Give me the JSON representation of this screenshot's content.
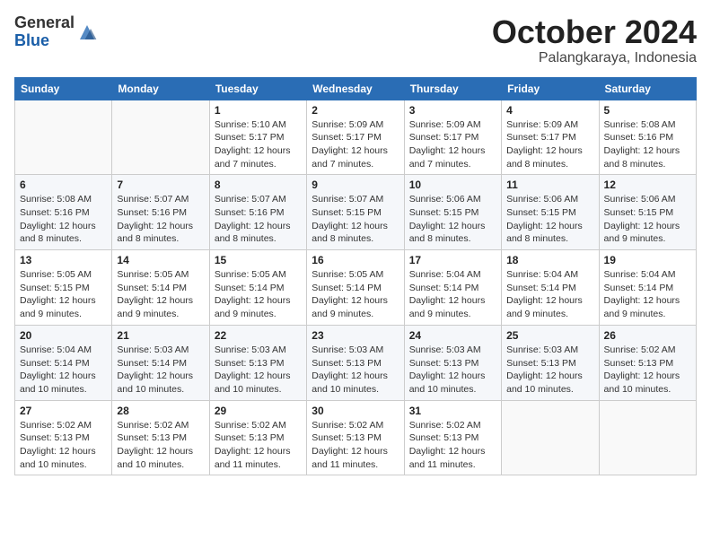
{
  "header": {
    "logo_general": "General",
    "logo_blue": "Blue",
    "month": "October 2024",
    "location": "Palangkaraya, Indonesia"
  },
  "days_of_week": [
    "Sunday",
    "Monday",
    "Tuesday",
    "Wednesday",
    "Thursday",
    "Friday",
    "Saturday"
  ],
  "weeks": [
    [
      {
        "day": "",
        "detail": ""
      },
      {
        "day": "",
        "detail": ""
      },
      {
        "day": "1",
        "detail": "Sunrise: 5:10 AM\nSunset: 5:17 PM\nDaylight: 12 hours\nand 7 minutes."
      },
      {
        "day": "2",
        "detail": "Sunrise: 5:09 AM\nSunset: 5:17 PM\nDaylight: 12 hours\nand 7 minutes."
      },
      {
        "day": "3",
        "detail": "Sunrise: 5:09 AM\nSunset: 5:17 PM\nDaylight: 12 hours\nand 7 minutes."
      },
      {
        "day": "4",
        "detail": "Sunrise: 5:09 AM\nSunset: 5:17 PM\nDaylight: 12 hours\nand 8 minutes."
      },
      {
        "day": "5",
        "detail": "Sunrise: 5:08 AM\nSunset: 5:16 PM\nDaylight: 12 hours\nand 8 minutes."
      }
    ],
    [
      {
        "day": "6",
        "detail": "Sunrise: 5:08 AM\nSunset: 5:16 PM\nDaylight: 12 hours\nand 8 minutes."
      },
      {
        "day": "7",
        "detail": "Sunrise: 5:07 AM\nSunset: 5:16 PM\nDaylight: 12 hours\nand 8 minutes."
      },
      {
        "day": "8",
        "detail": "Sunrise: 5:07 AM\nSunset: 5:16 PM\nDaylight: 12 hours\nand 8 minutes."
      },
      {
        "day": "9",
        "detail": "Sunrise: 5:07 AM\nSunset: 5:15 PM\nDaylight: 12 hours\nand 8 minutes."
      },
      {
        "day": "10",
        "detail": "Sunrise: 5:06 AM\nSunset: 5:15 PM\nDaylight: 12 hours\nand 8 minutes."
      },
      {
        "day": "11",
        "detail": "Sunrise: 5:06 AM\nSunset: 5:15 PM\nDaylight: 12 hours\nand 8 minutes."
      },
      {
        "day": "12",
        "detail": "Sunrise: 5:06 AM\nSunset: 5:15 PM\nDaylight: 12 hours\nand 9 minutes."
      }
    ],
    [
      {
        "day": "13",
        "detail": "Sunrise: 5:05 AM\nSunset: 5:15 PM\nDaylight: 12 hours\nand 9 minutes."
      },
      {
        "day": "14",
        "detail": "Sunrise: 5:05 AM\nSunset: 5:14 PM\nDaylight: 12 hours\nand 9 minutes."
      },
      {
        "day": "15",
        "detail": "Sunrise: 5:05 AM\nSunset: 5:14 PM\nDaylight: 12 hours\nand 9 minutes."
      },
      {
        "day": "16",
        "detail": "Sunrise: 5:05 AM\nSunset: 5:14 PM\nDaylight: 12 hours\nand 9 minutes."
      },
      {
        "day": "17",
        "detail": "Sunrise: 5:04 AM\nSunset: 5:14 PM\nDaylight: 12 hours\nand 9 minutes."
      },
      {
        "day": "18",
        "detail": "Sunrise: 5:04 AM\nSunset: 5:14 PM\nDaylight: 12 hours\nand 9 minutes."
      },
      {
        "day": "19",
        "detail": "Sunrise: 5:04 AM\nSunset: 5:14 PM\nDaylight: 12 hours\nand 9 minutes."
      }
    ],
    [
      {
        "day": "20",
        "detail": "Sunrise: 5:04 AM\nSunset: 5:14 PM\nDaylight: 12 hours\nand 10 minutes."
      },
      {
        "day": "21",
        "detail": "Sunrise: 5:03 AM\nSunset: 5:14 PM\nDaylight: 12 hours\nand 10 minutes."
      },
      {
        "day": "22",
        "detail": "Sunrise: 5:03 AM\nSunset: 5:13 PM\nDaylight: 12 hours\nand 10 minutes."
      },
      {
        "day": "23",
        "detail": "Sunrise: 5:03 AM\nSunset: 5:13 PM\nDaylight: 12 hours\nand 10 minutes."
      },
      {
        "day": "24",
        "detail": "Sunrise: 5:03 AM\nSunset: 5:13 PM\nDaylight: 12 hours\nand 10 minutes."
      },
      {
        "day": "25",
        "detail": "Sunrise: 5:03 AM\nSunset: 5:13 PM\nDaylight: 12 hours\nand 10 minutes."
      },
      {
        "day": "26",
        "detail": "Sunrise: 5:02 AM\nSunset: 5:13 PM\nDaylight: 12 hours\nand 10 minutes."
      }
    ],
    [
      {
        "day": "27",
        "detail": "Sunrise: 5:02 AM\nSunset: 5:13 PM\nDaylight: 12 hours\nand 10 minutes."
      },
      {
        "day": "28",
        "detail": "Sunrise: 5:02 AM\nSunset: 5:13 PM\nDaylight: 12 hours\nand 10 minutes."
      },
      {
        "day": "29",
        "detail": "Sunrise: 5:02 AM\nSunset: 5:13 PM\nDaylight: 12 hours\nand 11 minutes."
      },
      {
        "day": "30",
        "detail": "Sunrise: 5:02 AM\nSunset: 5:13 PM\nDaylight: 12 hours\nand 11 minutes."
      },
      {
        "day": "31",
        "detail": "Sunrise: 5:02 AM\nSunset: 5:13 PM\nDaylight: 12 hours\nand 11 minutes."
      },
      {
        "day": "",
        "detail": ""
      },
      {
        "day": "",
        "detail": ""
      }
    ]
  ]
}
